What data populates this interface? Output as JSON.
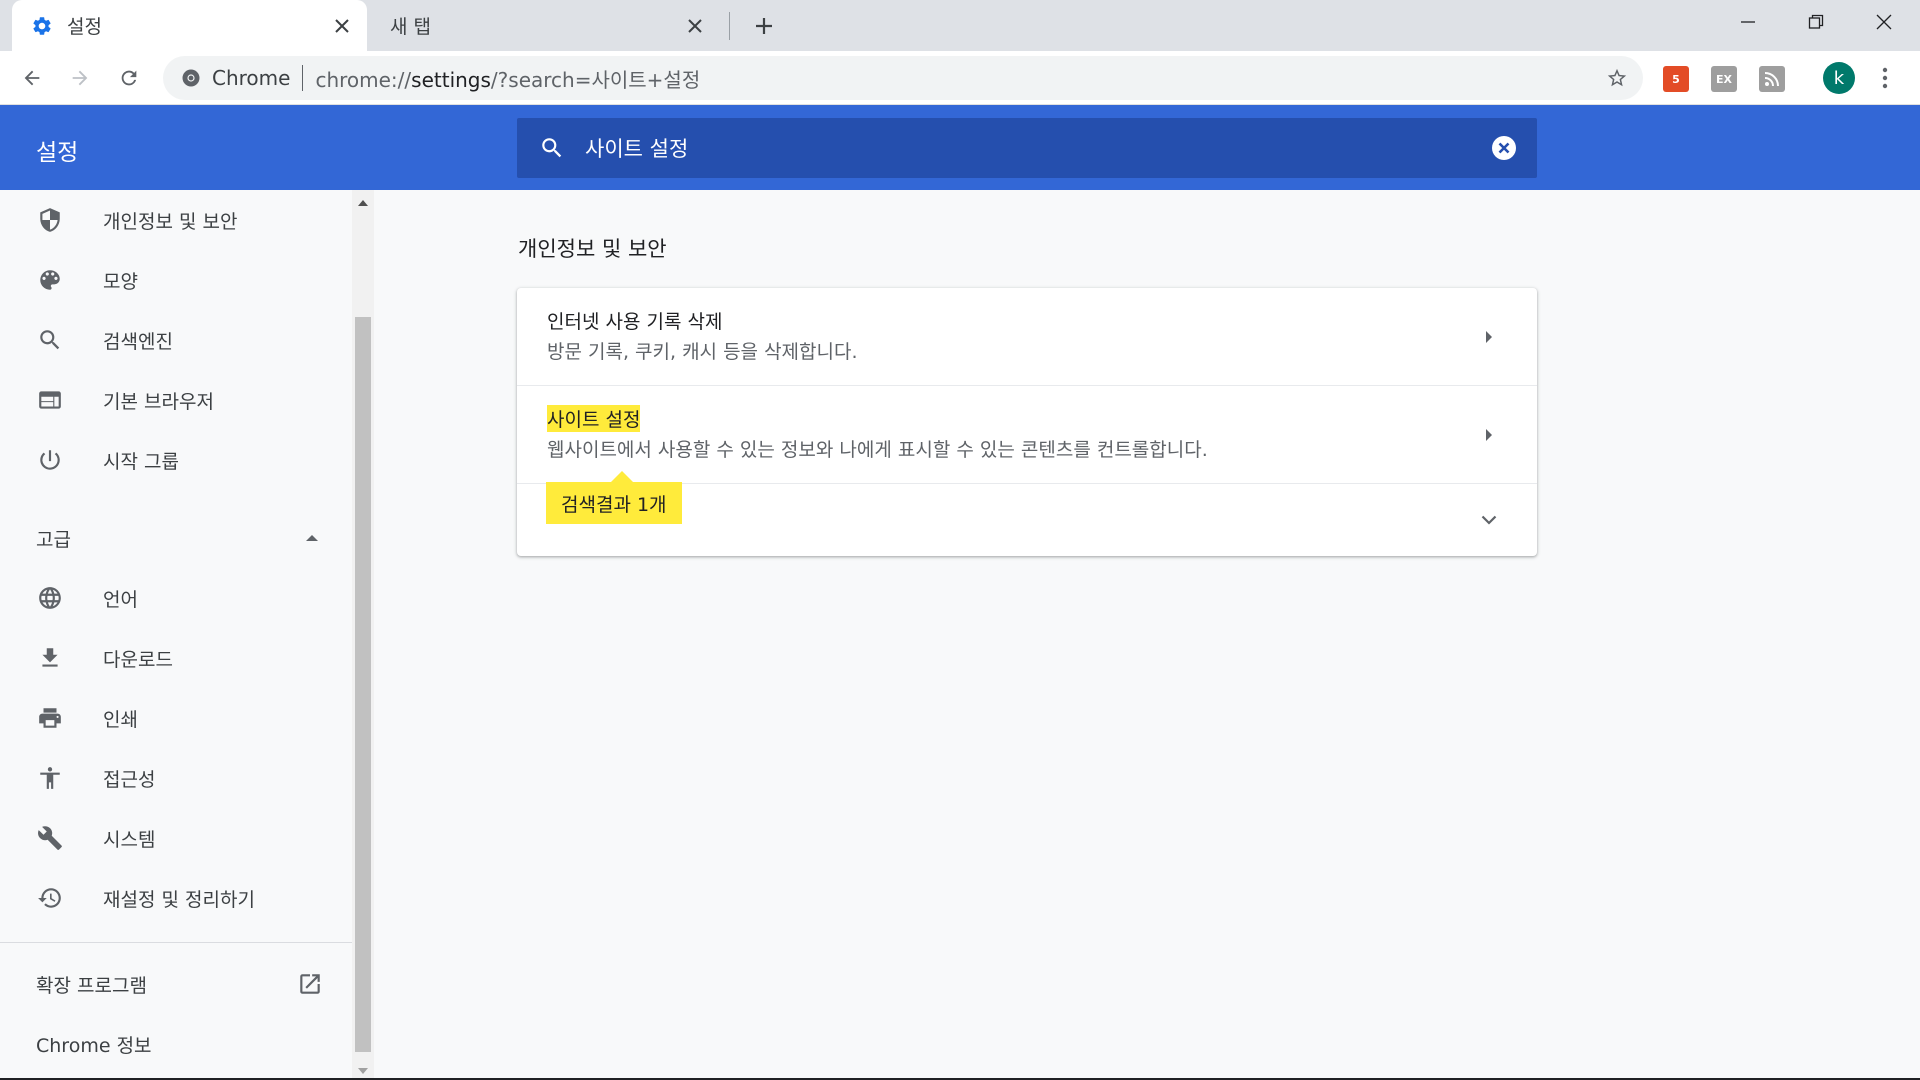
{
  "browser": {
    "tabs": [
      {
        "title": "설정",
        "icon": "gear-icon"
      },
      {
        "title": "새 탭"
      }
    ],
    "omnibox": {
      "chip": "Chrome",
      "url_prefix": "chrome://",
      "url_host": "settings",
      "url_rest": "/?search=사이트+설정"
    },
    "profile_initial": "k",
    "extensions": [
      {
        "name": "html5-extension-icon",
        "label": "5",
        "color": "#e34c26"
      },
      {
        "name": "ex-extension-icon",
        "label": "EX",
        "color": "#9e9e9e"
      },
      {
        "name": "rss-extension-icon",
        "label": "",
        "color": "#9e9e9e"
      }
    ]
  },
  "settings": {
    "title": "설정",
    "search_value": "사이트 설정"
  },
  "sidebar": {
    "items": [
      {
        "label": "개인정보 및 보안",
        "icon": "shield-icon"
      },
      {
        "label": "모양",
        "icon": "palette-icon"
      },
      {
        "label": "검색엔진",
        "icon": "search-icon"
      },
      {
        "label": "기본 브라우저",
        "icon": "browser-window-icon"
      },
      {
        "label": "시작 그룹",
        "icon": "power-icon"
      }
    ],
    "advanced_label": "고급",
    "advanced_items": [
      {
        "label": "언어",
        "icon": "globe-icon"
      },
      {
        "label": "다운로드",
        "icon": "download-icon"
      },
      {
        "label": "인쇄",
        "icon": "printer-icon"
      },
      {
        "label": "접근성",
        "icon": "accessibility-icon"
      },
      {
        "label": "시스템",
        "icon": "wrench-icon"
      },
      {
        "label": "재설정 및 정리하기",
        "icon": "restore-icon"
      }
    ],
    "extensions_label": "확장 프로그램",
    "about_label": "Chrome 정보"
  },
  "main": {
    "section_title": "개인정보 및 보안",
    "rows": [
      {
        "title": "인터넷 사용 기록 삭제",
        "subtitle": "방문 기록, 쿠키, 캐시 등을 삭제합니다."
      },
      {
        "title": "사이트 설정",
        "subtitle": "웹사이트에서 사용할 수 있는 정보와 나에게 표시할 수 있는 콘텐츠를 컨트롤합니다."
      },
      {
        "title": ""
      }
    ],
    "search_bubble": "검색결과 1개"
  },
  "colors": {
    "header_blue": "#3367d6",
    "search_blue": "#254fae",
    "highlight": "#ffeb3b"
  }
}
